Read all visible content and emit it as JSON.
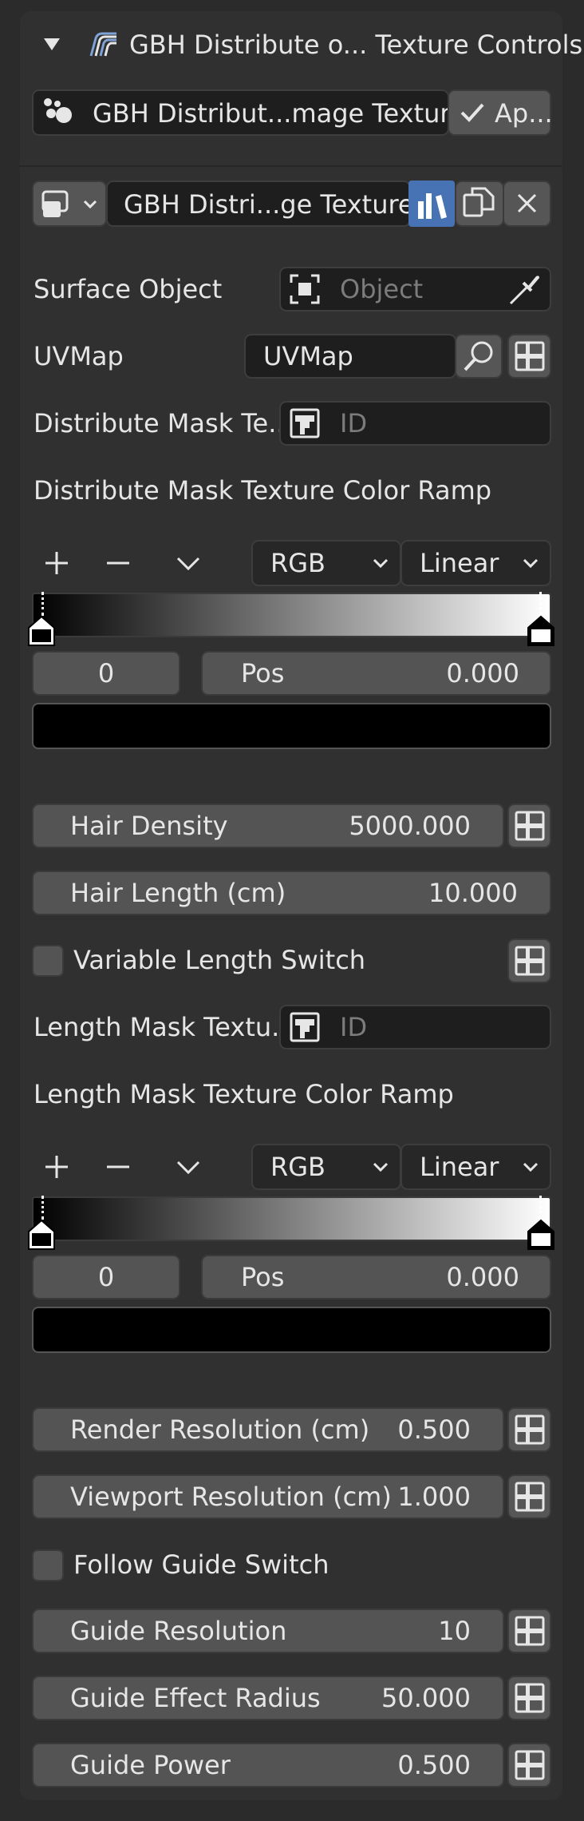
{
  "header": {
    "title": "GBH Distribute o... Texture Controls"
  },
  "node_group_row": {
    "name": "GBH Distribut...mage Texture",
    "apply_label": "Ap..."
  },
  "datablock_row": {
    "name": "GBH Distri...ge Texture"
  },
  "props": {
    "surface_object_label": "Surface Object",
    "surface_object_placeholder": "Object",
    "uvmap_label": "UVMap",
    "uvmap_value": "UVMap",
    "distribute_mask_label": "Distribute Mask Te...",
    "distribute_mask_placeholder": "ID",
    "distribute_ramp_title": "Distribute Mask Texture Color Ramp",
    "hair_density_label": "Hair Density",
    "hair_density_value": "5000.000",
    "hair_length_label": "Hair Length (cm)",
    "hair_length_value": "10.000",
    "variable_length_label": "Variable Length Switch",
    "length_mask_label": "Length Mask Textu...",
    "length_mask_placeholder": "ID",
    "length_ramp_title": "Length Mask Texture Color Ramp",
    "render_res_label": "Render Resolution (cm)",
    "render_res_value": "0.500",
    "viewport_res_label": "Viewport Resolution (cm)",
    "viewport_res_value": "1.000",
    "follow_guide_label": "Follow Guide Switch",
    "guide_res_label": "Guide Resolution",
    "guide_res_value": "10",
    "guide_radius_label": "Guide Effect Radius",
    "guide_radius_value": "50.000",
    "guide_power_label": "Guide Power",
    "guide_power_value": "0.500"
  },
  "ramp1": {
    "color_mode": "RGB",
    "interpolation": "Linear",
    "index": "0",
    "pos_label": "Pos",
    "pos_value": "0.000",
    "swatch_color": "#000000"
  },
  "ramp2": {
    "color_mode": "RGB",
    "interpolation": "Linear",
    "index": "0",
    "pos_label": "Pos",
    "pos_value": "0.000",
    "swatch_color": "#000000"
  },
  "colors": {
    "accent": "#4772b3",
    "background": "#303030",
    "field": "#545454",
    "dark_field": "#1e1e1e"
  },
  "icons": {
    "collapse": "triangle-down-icon",
    "node_tree": "node-tree-icon",
    "check": "check-icon",
    "browse": "browse-datablock-icon",
    "fake_user": "fake-user-icon",
    "duplicate": "duplicate-icon",
    "unlink": "close-icon",
    "object": "object-icon",
    "eyedropper": "eyedropper-icon",
    "search": "search-icon",
    "attribute": "attribute-toggle-icon",
    "texture": "texture-icon"
  }
}
